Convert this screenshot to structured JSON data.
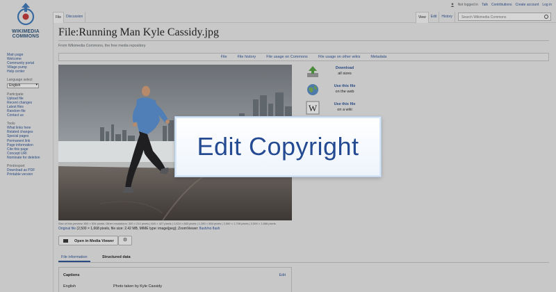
{
  "logo": {
    "line1": "WIKIMEDIA",
    "line2": "COMMONS"
  },
  "personal": {
    "not_logged_in": "Not logged in",
    "links": [
      "Talk",
      "Contributions",
      "Create account",
      "Log in"
    ]
  },
  "tabs_left": [
    "File",
    "Discussion"
  ],
  "tabs_right": [
    "View",
    "Edit",
    "History"
  ],
  "search": {
    "placeholder": "Search Wikimedia Commons"
  },
  "sidebar": {
    "main_links": [
      "Main page",
      "Welcome",
      "Community portal",
      "Village pump",
      "Help center"
    ],
    "language_label": "Language select",
    "language_value": "English",
    "participate_title": "Participate",
    "participate_links": [
      "Upload file",
      "Recent changes",
      "Latest files",
      "Random file",
      "Contact us"
    ],
    "tools_title": "Tools",
    "tools_links": [
      "What links here",
      "Related changes",
      "Special pages",
      "Permanent link",
      "Page information",
      "Cite this page",
      "Concept URI",
      "Nominate for deletion"
    ],
    "print_title": "Print/export",
    "print_links": [
      "Download as PDF",
      "Printable version"
    ]
  },
  "page": {
    "title": "File:Running Man Kyle Cassidy.jpg",
    "subtitle": "From Wikimedia Commons, the free media repository"
  },
  "filenav": [
    "File",
    "File history",
    "File usage on Commons",
    "File usage on other wikis",
    "Metadata"
  ],
  "usage": [
    {
      "l1": "Download",
      "l2": "all sizes",
      "icon": "download-icon"
    },
    {
      "l1": "Use this file",
      "l2": "on the web",
      "icon": "globe-icon"
    },
    {
      "l1": "Use this file",
      "l2": "on a wiki",
      "icon": "wikipedia-icon"
    }
  ],
  "size_line": "Size of this preview: 800 × 534 pixels. Other resolutions: 320 × 214 pixels | 640 × 427 pixels | 1,024 × 683 pixels | 1,280 × 854 pixels | 2,560 × 1,708 pixels | 2,500 × 1,668 pixels.",
  "original": {
    "link": "Original file",
    "rest": " (2,500 × 1,668 pixels, file size: 2.42 MB, MIME type: image/jpeg); ZoomViewer: ",
    "flash": "flash/no flash"
  },
  "media_viewer_label": "Open in Media Viewer",
  "info_tabs": [
    "File information",
    "Structured data"
  ],
  "captions": {
    "heading": "Captions",
    "edit": "Edit",
    "language": "English",
    "value": "Photo taken by Kyle Cassidy"
  },
  "overlay": {
    "text": "Edit Copyright"
  },
  "colors": {
    "link": "#2a4a82",
    "overlay_text": "#244a92",
    "dim_bg": "#c8c8c8"
  }
}
